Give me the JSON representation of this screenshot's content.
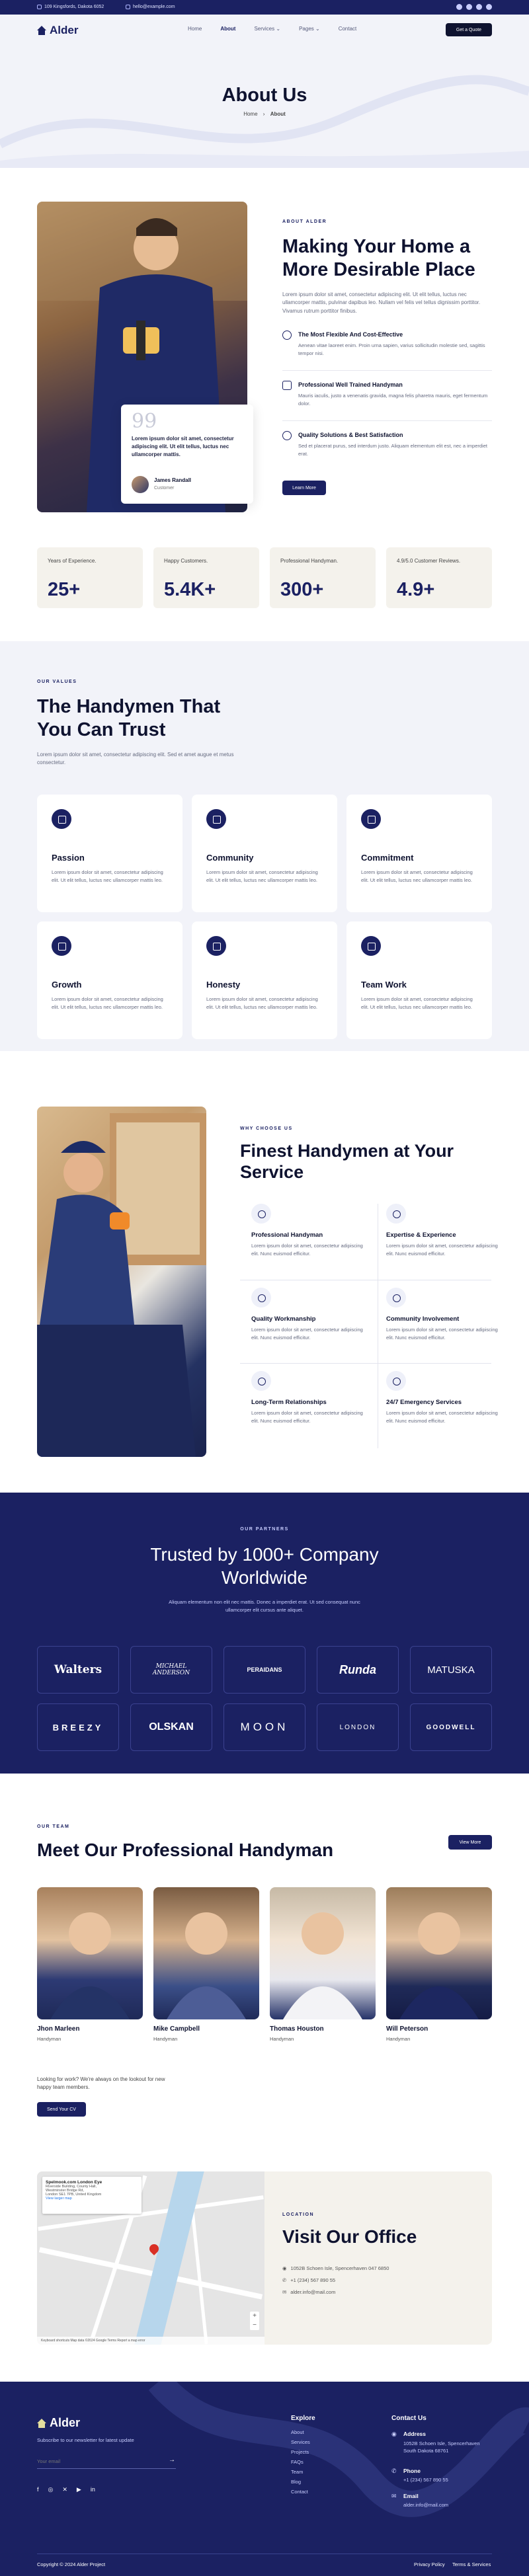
{
  "topbar": {
    "address": "109 Kingsfords, Dakota 6052",
    "email": "hello@example.com",
    "social": [
      "facebook-icon",
      "twitter-icon",
      "youtube-icon",
      "linkedin-icon"
    ]
  },
  "nav": {
    "brand": "Alder",
    "items": [
      {
        "label": "Home",
        "active": false
      },
      {
        "label": "About",
        "active": true
      },
      {
        "label": "Services",
        "caret": true,
        "active": false
      },
      {
        "label": "Pages",
        "caret": true,
        "active": false
      },
      {
        "label": "Contact",
        "active": false
      }
    ],
    "cta": "Get a Quote"
  },
  "hero": {
    "title": "About Us",
    "crumb_home": "Home",
    "crumb_current": "About"
  },
  "about": {
    "kicker": "ABOUT ALDER",
    "title_line1": "Making Your Home a",
    "title_line2": "More Desirable Place",
    "intro": "Lorem ipsum dolor sit amet, consectetur adipiscing elit. Ut elit tellus, luctus nec ullamcorper mattis, pulvinar dapibus leo. Nullam vel felis vel tellus dignissim porttitor. Vivamus rutrum porttitor finibus.",
    "features": [
      {
        "icon": "check-circle-icon",
        "title": "The Most Flexible And Cost-Effective",
        "text": "Aenean vitae laoreet enim. Proin urna sapien, varius sollicitudin molestie sed, sagittis tempor nisi."
      },
      {
        "icon": "toolbox-icon",
        "title": "Professional Well Trained Handyman",
        "text": "Mauris iaculis, justo a venenatis gravida, magna felis pharetra mauris, eget fermentum dolor."
      },
      {
        "icon": "badge-icon",
        "title": "Quality Solutions & Best Satisfaction",
        "text": "Sed et placerat purus, sed interdum justo. Aliquam elementum elit est, nec a imperdiet erat."
      }
    ],
    "cta": "Learn More",
    "quote": {
      "mark": "99",
      "text": "Lorem ipsum dolor sit amet, consectetur adipiscing elit. Ut elit tellus, luctus nec ullamcorper mattis.",
      "author": "James Randall",
      "role": "Customer"
    }
  },
  "stats": [
    {
      "label": "Years of Experience.",
      "value": "25+"
    },
    {
      "label": "Happy Customers.",
      "value": "5.4K+"
    },
    {
      "label": "Professional Handyman.",
      "value": "300+"
    },
    {
      "label": "4.9/5.0 Customer Reviews.",
      "value": "4.9+"
    }
  ],
  "values": {
    "kicker": "OUR VALUES",
    "title_line1": "The Handymen That",
    "title_line2": "You Can Trust",
    "intro": "Lorem ipsum dolor sit amet, consectetur adipiscing elit. Sed et amet augue et metus consectetur.",
    "items": [
      {
        "icon": "feather-icon",
        "title": "Passion",
        "text": "Lorem ipsum dolor sit amet, consectetur adipiscing elit. Ut elit tellus, luctus nec ullamcorper mattis leo."
      },
      {
        "icon": "handshake-icon",
        "title": "Community",
        "text": "Lorem ipsum dolor sit amet, consectetur adipiscing elit. Ut elit tellus, luctus nec ullamcorper mattis leo."
      },
      {
        "icon": "target-icon",
        "title": "Commitment",
        "text": "Lorem ipsum dolor sit amet, consectetur adipiscing elit. Ut elit tellus, luctus nec ullamcorper mattis leo."
      },
      {
        "icon": "chart-icon",
        "title": "Growth",
        "text": "Lorem ipsum dolor sit amet, consectetur adipiscing elit. Ut elit tellus, luctus nec ullamcorper mattis leo."
      },
      {
        "icon": "lock-icon",
        "title": "Honesty",
        "text": "Lorem ipsum dolor sit amet, consectetur adipiscing elit. Ut elit tellus, luctus nec ullamcorper mattis leo."
      },
      {
        "icon": "team-icon",
        "title": "Team Work",
        "text": "Lorem ipsum dolor sit amet, consectetur adipiscing elit. Ut elit tellus, luctus nec ullamcorper mattis leo."
      }
    ]
  },
  "why": {
    "kicker": "WHY CHOOSE US",
    "title_line1": "Finest Handymen at Your",
    "title_line2": "Service",
    "items": [
      {
        "icon": "toolbox-icon",
        "title": "Professional Handyman",
        "text": "Lorem ipsum dolor sit amet, consectetur adipiscing elit. Nunc euismod efficitur."
      },
      {
        "icon": "wrench-icon",
        "title": "Expertise & Experience",
        "text": "Lorem ipsum dolor sit amet, consectetur adipiscing elit. Nunc euismod efficitur."
      },
      {
        "icon": "medal-icon",
        "title": "Quality Workmanship",
        "text": "Lorem ipsum dolor sit amet, consectetur adipiscing elit. Nunc euismod efficitur."
      },
      {
        "icon": "people-icon",
        "title": "Community Involvement",
        "text": "Lorem ipsum dolor sit amet, consectetur adipiscing elit. Nunc euismod efficitur."
      },
      {
        "icon": "clock-icon",
        "title": "Long-Term Relationships",
        "text": "Lorem ipsum dolor sit amet, consectetur adipiscing elit. Nunc euismod efficitur."
      },
      {
        "icon": "alarm-icon",
        "title": "24/7 Emergency Services",
        "text": "Lorem ipsum dolor sit amet, consectetur adipiscing elit. Nunc euismod efficitur."
      }
    ]
  },
  "partners": {
    "kicker": "OUR PARTNERS",
    "title_line1": "Trusted by 1000+ Company",
    "title_line2": "Worldwide",
    "intro": "Aliquam elementum non elit nec mattis. Donec a imperdiet erat. Ut sed consequat nunc ullamcorper elit cursus ante aliquet.",
    "logos": [
      "Walters",
      "MICHAEL ANDERSON",
      "PERAIDANS",
      "Runda",
      "MATUSKA",
      "BREEZY",
      "OLSKAN",
      "MOON",
      "LONDON",
      "GOODWELL"
    ]
  },
  "team": {
    "kicker": "OUR TEAM",
    "title": "Meet Our Professional Handyman",
    "view_more": "View More",
    "members": [
      {
        "name": "Jhon Marleen",
        "role": "Handyman"
      },
      {
        "name": "Mike Campbell",
        "role": "Handyman"
      },
      {
        "name": "Thomas Houston",
        "role": "Handyman"
      },
      {
        "name": "Will Peterson",
        "role": "Handyman"
      }
    ],
    "hiring_text": "Looking for work? We're always on the lookout for new happy team members.",
    "hiring_cta": "Send Your CV"
  },
  "office": {
    "kicker": "LOCATION",
    "title": "Visit Our Office",
    "address": "1052B Schoen Isle, Spencerhaven 047 6850",
    "phone": "+1 (234) 567 890 55",
    "email": "alder.info@mail.com",
    "map_label_title": "Spelmook.com London Eye",
    "map_label_line1": "Riverside Building, County Hall,",
    "map_label_line2": "Westminster Bridge Rd,",
    "map_label_line3": "London SE1 7PB, United Kingdom",
    "map_link": "View larger map",
    "map_footer": "Keyboard shortcuts   Map data ©2024 Google   Terms   Report a map error"
  },
  "footer": {
    "brand": "Alder",
    "subscribe_text": "Subscribe to our newsletter for latest update",
    "email_placeholder": "Your email",
    "social": [
      "facebook-icon",
      "instagram-icon",
      "x-icon",
      "youtube-icon",
      "linkedin-icon"
    ],
    "explore_title": "Explore",
    "explore_links": [
      "About",
      "Services",
      "Projects",
      "FAQs",
      "Team",
      "Blog",
      "Contact"
    ],
    "contact_title": "Contact Us",
    "address_label": "Address",
    "address": "1052B Schoen Isle, Spencerhaven South Dakota 68761",
    "phone_label": "Phone",
    "phone": "+1 (234) 567 890 55",
    "email_label": "Email",
    "email": "alder.info@mail.com",
    "copyright": "Copyright © 2024 Alder Project",
    "legal": [
      "Privacy Policy",
      "Terms & Services"
    ]
  },
  "colors": {
    "navy": "#1b2162",
    "dark": "#0f1330",
    "light_bg": "#f2f3f9",
    "beige": "#f4f2ec"
  }
}
